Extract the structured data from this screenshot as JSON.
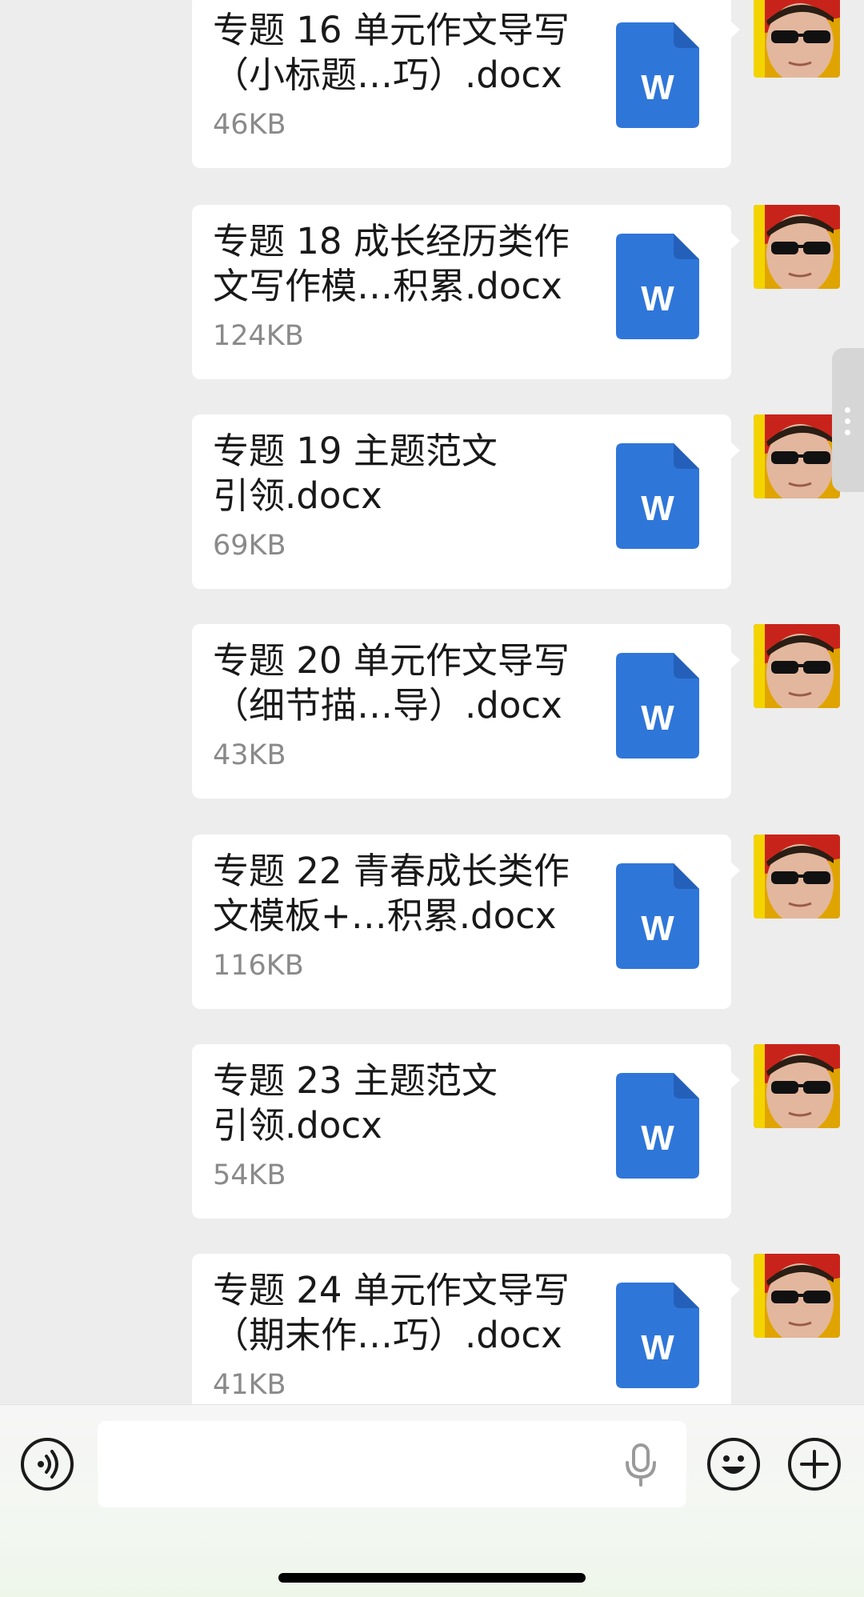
{
  "messages": [
    {
      "name_line1": "专题 16 单元作文导写",
      "name_line2": "（小标题…巧）.docx",
      "size": "46KB"
    },
    {
      "name_line1": "专题 18 成长经历类作",
      "name_line2": "文写作模…积累.docx",
      "size": "124KB"
    },
    {
      "name_line1": "专题 19 主题范文",
      "name_line2": "引领.docx",
      "size": "69KB"
    },
    {
      "name_line1": "专题 20 单元作文导写",
      "name_line2": "（细节描…导）.docx",
      "size": "43KB"
    },
    {
      "name_line1": "专题 22 青春成长类作",
      "name_line2": "文模板+…积累.docx",
      "size": "116KB"
    },
    {
      "name_line1": "专题 23 主题范文",
      "name_line2": "引领.docx",
      "size": "54KB"
    },
    {
      "name_line1": "专题 24 单元作文导写",
      "name_line2": "（期末作…巧）.docx",
      "size": "41KB"
    }
  ],
  "file_icon": {
    "letter": "W",
    "color": "#2f76d9",
    "fold_color": "#2460b9",
    "name": "word-doc-icon"
  },
  "input_bar": {
    "voice_icon": "voice-mode-icon",
    "mic_icon": "microphone-icon",
    "emoji_icon": "emoji-icon",
    "add_icon": "plus-icon",
    "text_value": ""
  },
  "colors": {
    "chat_background": "#ededed",
    "bubble": "#ffffff",
    "accent_doc": "#2f76d9"
  }
}
